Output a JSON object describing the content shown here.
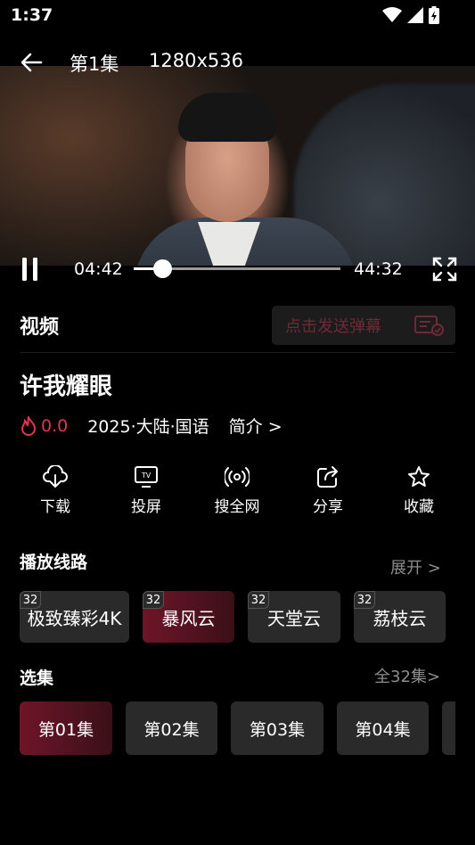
{
  "status": {
    "time": "1:37"
  },
  "player": {
    "episode_title": "第1集",
    "resolution": "1280x536",
    "current_time": "04:42",
    "total_time": "44:32",
    "progress_fraction": 0.138
  },
  "section": {
    "video_label": "视频",
    "danmaku_placeholder": "点击发送弹幕"
  },
  "show": {
    "title": "许我耀眼",
    "rating": "0.0",
    "meta": "2025·大陆·国语",
    "intro_link": "简介 >"
  },
  "actions": [
    {
      "label": "下载",
      "icon": "download-icon"
    },
    {
      "label": "投屏",
      "icon": "tv-cast-icon"
    },
    {
      "label": "搜全网",
      "icon": "broadcast-icon"
    },
    {
      "label": "分享",
      "icon": "share-icon"
    },
    {
      "label": "收藏",
      "icon": "star-icon"
    }
  ],
  "routes": {
    "heading": "播放线路",
    "expand": "展开 >",
    "items": [
      {
        "label": "极致臻彩4K",
        "badge": "32",
        "active": false
      },
      {
        "label": "暴风云",
        "badge": "32",
        "active": true
      },
      {
        "label": "天堂云",
        "badge": "32",
        "active": false
      },
      {
        "label": "荔枝云",
        "badge": "32",
        "active": false
      }
    ]
  },
  "episodes": {
    "heading": "选集",
    "all": "全32集>",
    "items": [
      {
        "label": "第01集",
        "active": true
      },
      {
        "label": "第02集",
        "active": false
      },
      {
        "label": "第03集",
        "active": false
      },
      {
        "label": "第04集",
        "active": false
      }
    ]
  },
  "colors": {
    "accent": "#e0374f",
    "active_chip": "#6e1528",
    "chip_bg": "#2a2a2a"
  }
}
